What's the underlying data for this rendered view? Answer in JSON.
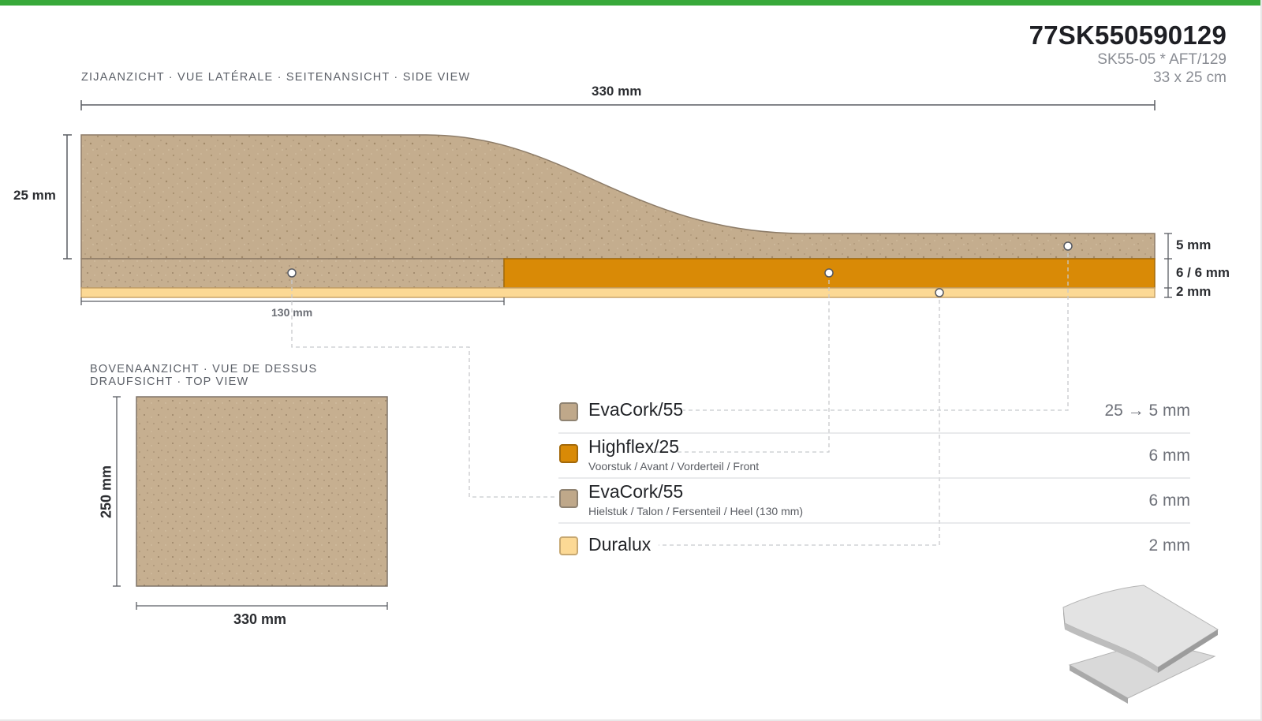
{
  "header": {
    "code": "77SK550590129",
    "model": "SK55-05 * AFT/129",
    "size": "33 x 25 cm"
  },
  "side_view": {
    "title": "ZIJAANZICHT · VUE LATÉRALE · SEITENANSICHT · SIDE VIEW",
    "length_label": "330 mm",
    "height_label": "25 mm",
    "heel_length_label": "130 mm",
    "layer_labels": [
      "5 mm",
      "6 / 6 mm",
      "2 mm"
    ]
  },
  "top_view": {
    "title_line1": "BOVENAANZICHT · VUE DE DESSUS",
    "title_line2": "DRAUFSICHT · TOP VIEW",
    "width_label": "330 mm",
    "height_label": "250 mm"
  },
  "legend": [
    {
      "name": "EvaCork/55",
      "note": "",
      "value": "25 → 5 mm",
      "color": "#bfa88a"
    },
    {
      "name": "Highflex/25",
      "note": "Voorstuk / Avant / Vorderteil / Front",
      "value": "6 mm",
      "color": "#d98a06"
    },
    {
      "name": "EvaCork/55",
      "note": "Hielstuk / Talon / Fersenteil / Heel (130 mm)",
      "value": "6 mm",
      "color": "#bfa88a"
    },
    {
      "name": "Duralux",
      "note": "",
      "value": "2 mm",
      "color": "#fcd995"
    }
  ],
  "colors": {
    "accent_bar": "#38a93a",
    "evacork": "#bfa88a",
    "highflex": "#d98a06",
    "duralux": "#fcd995"
  }
}
